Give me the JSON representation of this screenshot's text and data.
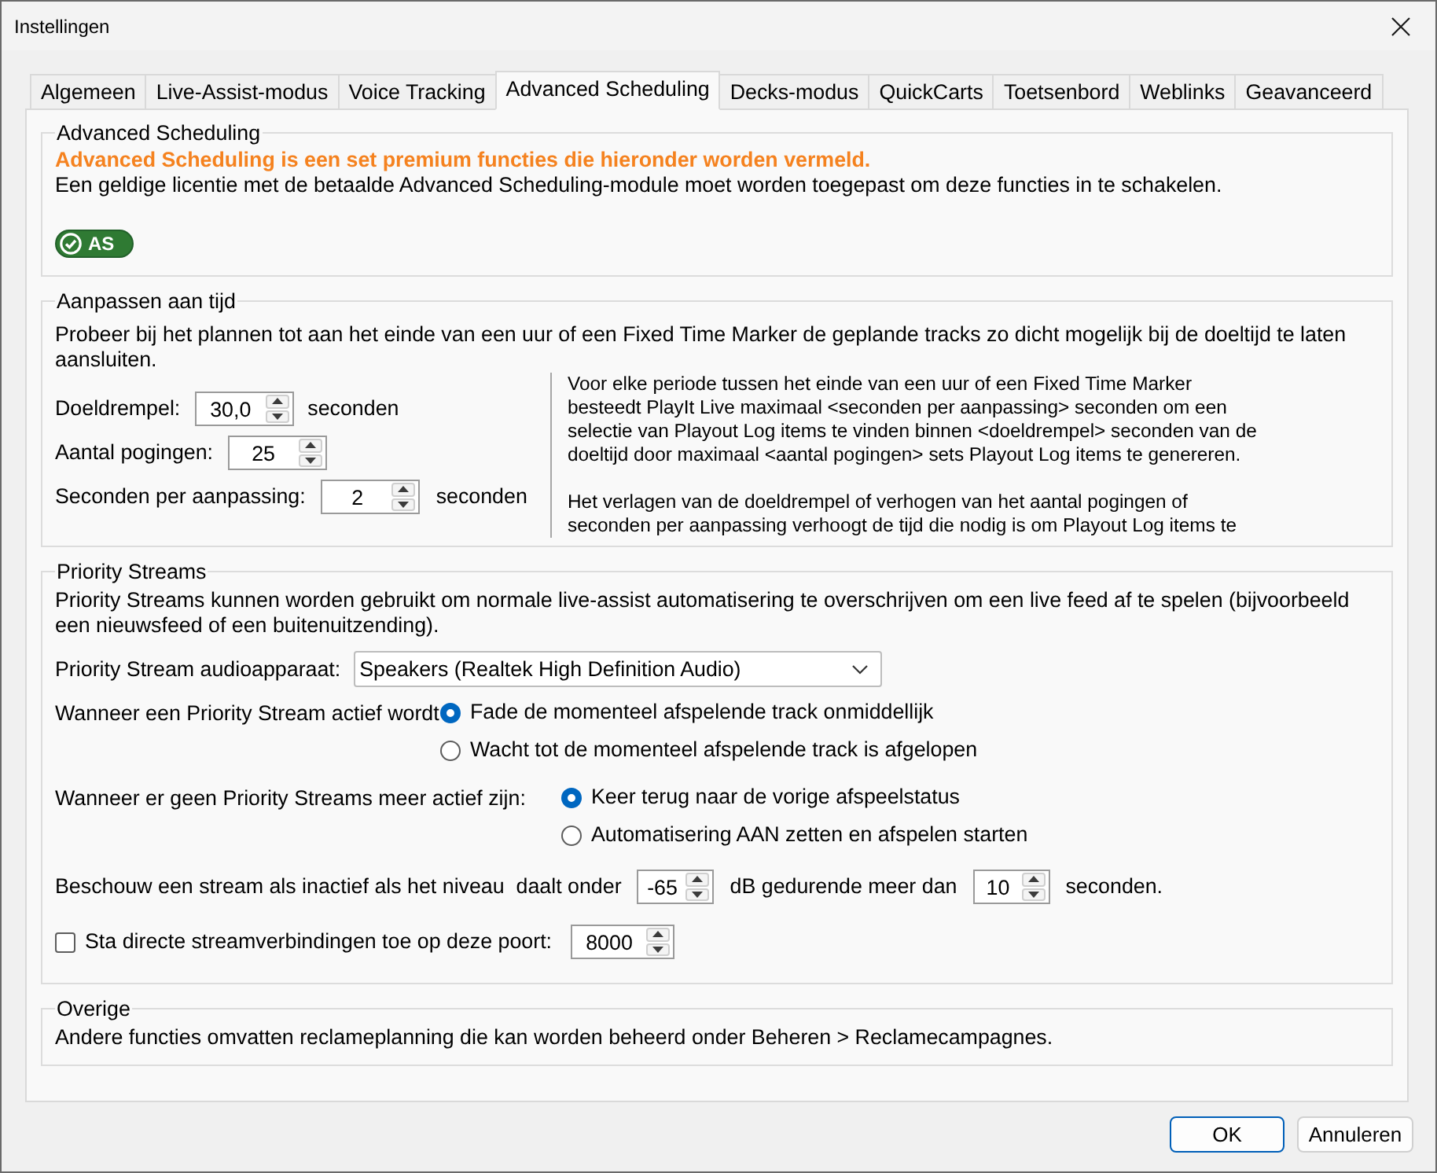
{
  "window": {
    "title": "Instellingen"
  },
  "tabs": [
    {
      "label": "Algemeen",
      "selected": false
    },
    {
      "label": "Live-Assist-modus",
      "selected": false
    },
    {
      "label": "Voice Tracking",
      "selected": false
    },
    {
      "label": "Advanced Scheduling",
      "selected": true
    },
    {
      "label": "Decks-modus",
      "selected": false
    },
    {
      "label": "QuickCarts",
      "selected": false
    },
    {
      "label": "Toetsenbord",
      "selected": false
    },
    {
      "label": "Weblinks",
      "selected": false
    },
    {
      "label": "Geavanceerd",
      "selected": false
    }
  ],
  "advanced_scheduling": {
    "title": "Advanced Scheduling",
    "notice": "Advanced Scheduling is een set premium functies die hieronder worden vermeld.",
    "description": "Een geldige licentie met de betaalde Advanced Scheduling-module moet worden toegepast om deze functies in te schakelen.",
    "badge": "AS"
  },
  "adjust_to_time": {
    "title": "Aanpassen aan tijd",
    "description": "Probeer bij het plannen tot aan het einde van een uur of een Fixed Time Marker de geplande tracks zo dicht mogelijk bij de doeltijd te laten aansluiten.",
    "fields": [
      {
        "label": "Doeldrempel:",
        "value": "30,0",
        "unit": "seconden"
      },
      {
        "label": "Aantal pogingen:",
        "value": "25"
      },
      {
        "label": "Seconden per aanpassing:",
        "value": "2",
        "unit": "seconden"
      }
    ],
    "help": [
      "Voor elke periode tussen het einde van een uur of een Fixed Time Marker besteedt PlayIt Live maximaal <seconden per aanpassing> seconden om een selectie van Playout Log items te vinden binnen <doeldrempel> seconden van de doeltijd door maximaal <aantal pogingen> sets Playout Log items te genereren.",
      "Het verlagen van de doeldrempel of verhogen van het aantal pogingen of seconden per aanpassing verhoogt de tijd die nodig is om Playout Log items te"
    ]
  },
  "priority_streams": {
    "title": "Priority Streams",
    "description": "Priority Streams kunnen worden gebruikt om normale live-assist automatisering te overschrijven om een live feed af te spelen (bijvoorbeeld een nieuwsfeed of een buitenuitzending).",
    "device": {
      "label": "Priority Stream audioapparaat:",
      "value": "Speakers (Realtek High Definition Audio)"
    },
    "on_active": {
      "label": "Wanneer een Priority Stream actief wordt",
      "options": [
        {
          "label": "Fade de momenteel afspelende track onmiddellijk",
          "selected": true
        },
        {
          "label": "Wacht tot de momenteel afspelende track is afgelopen",
          "selected": false
        }
      ]
    },
    "on_inactive": {
      "label": "Wanneer er geen Priority Streams meer actief zijn:",
      "options": [
        {
          "label": "Keer terug naar de vorige afspeelstatus",
          "selected": true
        },
        {
          "label": "Automatisering AAN zetten en afspelen starten",
          "selected": false
        }
      ]
    },
    "threshold": {
      "label": "Beschouw een stream als inactief als het niveau  daalt onder",
      "db_value": "-65",
      "db_label": "dB gedurende meer dan",
      "seconds_value": "10",
      "seconds_label": "seconden."
    },
    "direct_connections": {
      "label": "Sta directe streamverbindingen toe op deze poort:",
      "checked": false,
      "port": "8000"
    }
  },
  "other": {
    "title": "Overige",
    "description": "Andere functies omvatten reclameplanning die kan worden beheerd onder Beheren > Reclamecampagnes."
  },
  "buttons": [
    {
      "label": "OK",
      "default": true
    },
    {
      "label": "Annuleren",
      "default": false
    }
  ]
}
